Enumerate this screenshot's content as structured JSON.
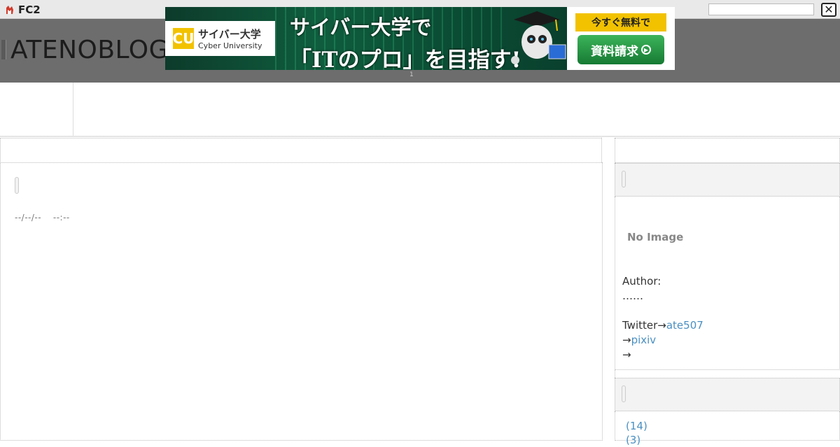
{
  "fc2bar": {
    "logo_text": "FC2"
  },
  "header": {
    "blog_title": "ATENOBLOG"
  },
  "ad": {
    "logo_mark": "CU",
    "logo_jp": "サイバー大学",
    "logo_en": "Cyber University",
    "headline_1": "サイバー大学で",
    "headline_2": "「ITのプロ」を目指す!",
    "ribbon": "今すぐ無料で",
    "button": "資料請求",
    "counter": "1"
  },
  "post": {
    "date_time": "--/--/--　 --:--"
  },
  "sidebar": {
    "no_image": "No Image",
    "author_label": "Author:",
    "author_name": "……",
    "twitter_prefix": "Twitter→",
    "twitter_handle": "ate507",
    "pixiv_prefix": "→",
    "pixiv_link": "pixiv",
    "extra_arrow": "→",
    "categories": [
      "(14)",
      "(3)"
    ]
  },
  "icons": {
    "close": "close-icon",
    "fc2": "fc2-logo-icon"
  }
}
